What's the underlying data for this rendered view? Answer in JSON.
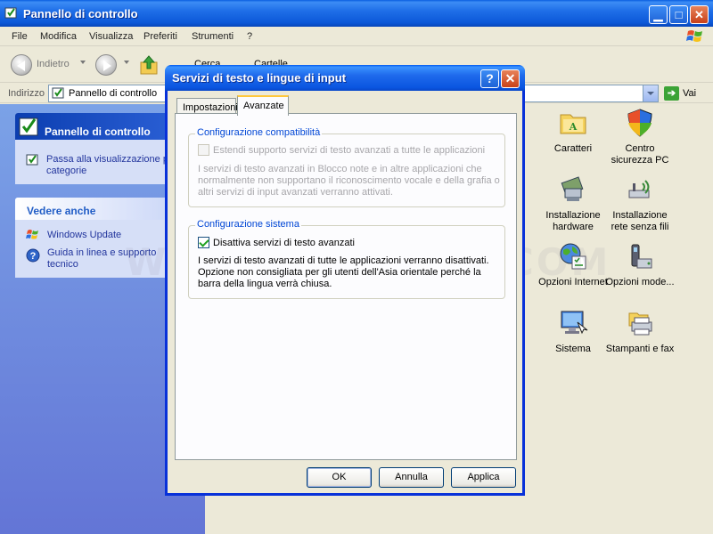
{
  "window": {
    "title": "Pannello di controllo",
    "menus": [
      "File",
      "Modifica",
      "Visualizza",
      "Preferiti",
      "Strumenti",
      "?"
    ],
    "toolbar": {
      "back_label": "Indietro",
      "search_label": "Cerca",
      "folders_label": "Cartelle"
    },
    "address": {
      "label": "Indirizzo",
      "value": "Pannello di controllo",
      "go_label": "Vai"
    }
  },
  "left_pane": {
    "control_panel_title": "Pannello di controllo",
    "switch_link": "Passa alla visualizzazione per categorie",
    "see_also_title": "Vedere anche",
    "see_also_links": [
      "Windows Update",
      "Guida in linea e supporto tecnico"
    ]
  },
  "items": [
    {
      "label": "Caratteri",
      "icon": "fonts-folder-icon"
    },
    {
      "label": "Centro sicurezza PC",
      "icon": "security-shield-icon"
    },
    {
      "label": "Installazione hardware",
      "icon": "hardware-icon"
    },
    {
      "label": "Installazione rete senza fili",
      "icon": "wireless-icon"
    },
    {
      "label": "Opzioni Internet",
      "icon": "internet-options-icon"
    },
    {
      "label": "Opzioni mode...",
      "icon": "modem-icon"
    },
    {
      "label": "Sistema",
      "icon": "system-icon"
    },
    {
      "label": "Stampanti e fax",
      "icon": "printers-icon"
    }
  ],
  "watermark": "WWW.ITALIASW.COM",
  "dialog": {
    "title": "Servizi di testo e lingue di input",
    "tabs": [
      "Impostazioni",
      "Avanzate"
    ],
    "active_tab": "Avanzate",
    "compat_group": {
      "title": "Configurazione compatibilità",
      "checkbox_label": "Estendi supporto servizi di testo avanzati a tutte le applicazioni",
      "checked": false,
      "enabled": false,
      "description": "I servizi di testo avanzati in Blocco note e in altre applicazioni che normalmente non supportano il riconoscimento vocale e della grafia o altri servizi di input avanzati verranno attivati."
    },
    "system_group": {
      "title": "Configurazione sistema",
      "checkbox_label": "Disattiva servizi di testo avanzati",
      "checked": true,
      "description": "I servizi di testo avanzati di tutte le applicazioni verranno disattivati. Opzione non consigliata per gli utenti dell'Asia orientale perché la barra della lingua verrà chiusa."
    },
    "buttons": {
      "ok": "OK",
      "cancel": "Annulla",
      "apply": "Applica"
    }
  }
}
